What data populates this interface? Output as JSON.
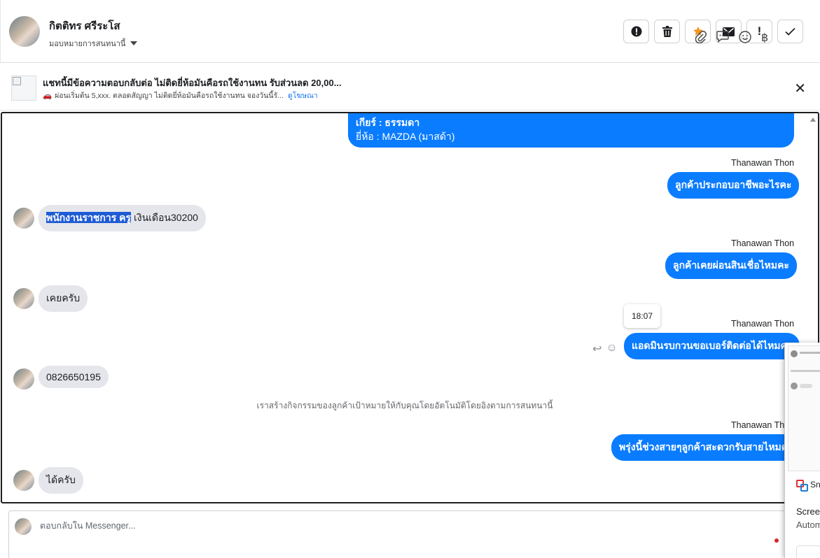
{
  "header": {
    "name": "กิตติทร ศรีระโส",
    "assign_label": "มอบหมายการสนทนานี้",
    "actions": [
      {
        "icon": "alert-circle-icon",
        "glyph": "❗"
      },
      {
        "icon": "trash-icon",
        "glyph": "🗑"
      },
      {
        "icon": "star-icon",
        "glyph": "★"
      },
      {
        "icon": "envelope-icon",
        "glyph": "✉"
      },
      {
        "icon": "exclamation-icon",
        "glyph": "!"
      },
      {
        "icon": "checkmark-icon",
        "glyph": "✓"
      }
    ],
    "star_color": "#f7931e"
  },
  "ad": {
    "title": "แชทนี้มีข้อความตอบกลับต่อ ไม่ติดยี่ห้อมันคือรถใช้งานทน รับส่วนลด 20,00...",
    "subtitle": "ผ่อนเริ่มต้น 5,xxx. ตลอดสัญญา ไม่ติดยี่ห้อมันคือรถใช้งานทน จองวันนี้รั...",
    "link": "ดูโฆษณา",
    "close": "✕"
  },
  "conversation": {
    "top_bubble": {
      "line1": "เกียร์ : ธรรมดา",
      "line2": "ยี่ห้อ : MAZDA (มาสด้า)"
    },
    "messages": [
      {
        "sender": "Thanawan Thon",
        "text": "ลูกค้าประกอบอาชีพอะไรคะ"
      },
      {
        "highlighted": "พนักงานราชการ ครู",
        "rest": " เงินเดือน30200"
      },
      {
        "sender": "Thanawan Thon",
        "text": "ลูกค้าเคยผ่อนสินเชื่อไหมคะ"
      },
      {
        "text": "เคยครับ"
      },
      {
        "sender": "Thanawan Thon",
        "text": "แอดมินรบกวนขอเบอร์ติดต่อได้ไหมคะ",
        "time": "18:07"
      },
      {
        "text": "0826650195"
      },
      {
        "sender": "Thanawan Thon",
        "text": "พรุ่งนี้ช่วงสายๆลูกค้าสะดวกรับสายไหมคะ"
      },
      {
        "text": "ได้ครับ"
      }
    ],
    "system_note": "เราสร้างกิจกรรมของลูกค้าเป้าหมายให้กับคุณโดยอัตโนมัติโดยอิงตามการสนทนานี้",
    "outgoing_color": "#0a7cff",
    "incoming_color": "#e4e6eb"
  },
  "side_panel": {
    "app": "Sn",
    "line1": "Screen",
    "line2": "Autom"
  },
  "composer": {
    "placeholder": "ตอบกลับใน Messenger...",
    "tools": [
      "paperclip-icon",
      "chat-bubble-icon",
      "smiley-icon",
      "baht-icon"
    ]
  }
}
